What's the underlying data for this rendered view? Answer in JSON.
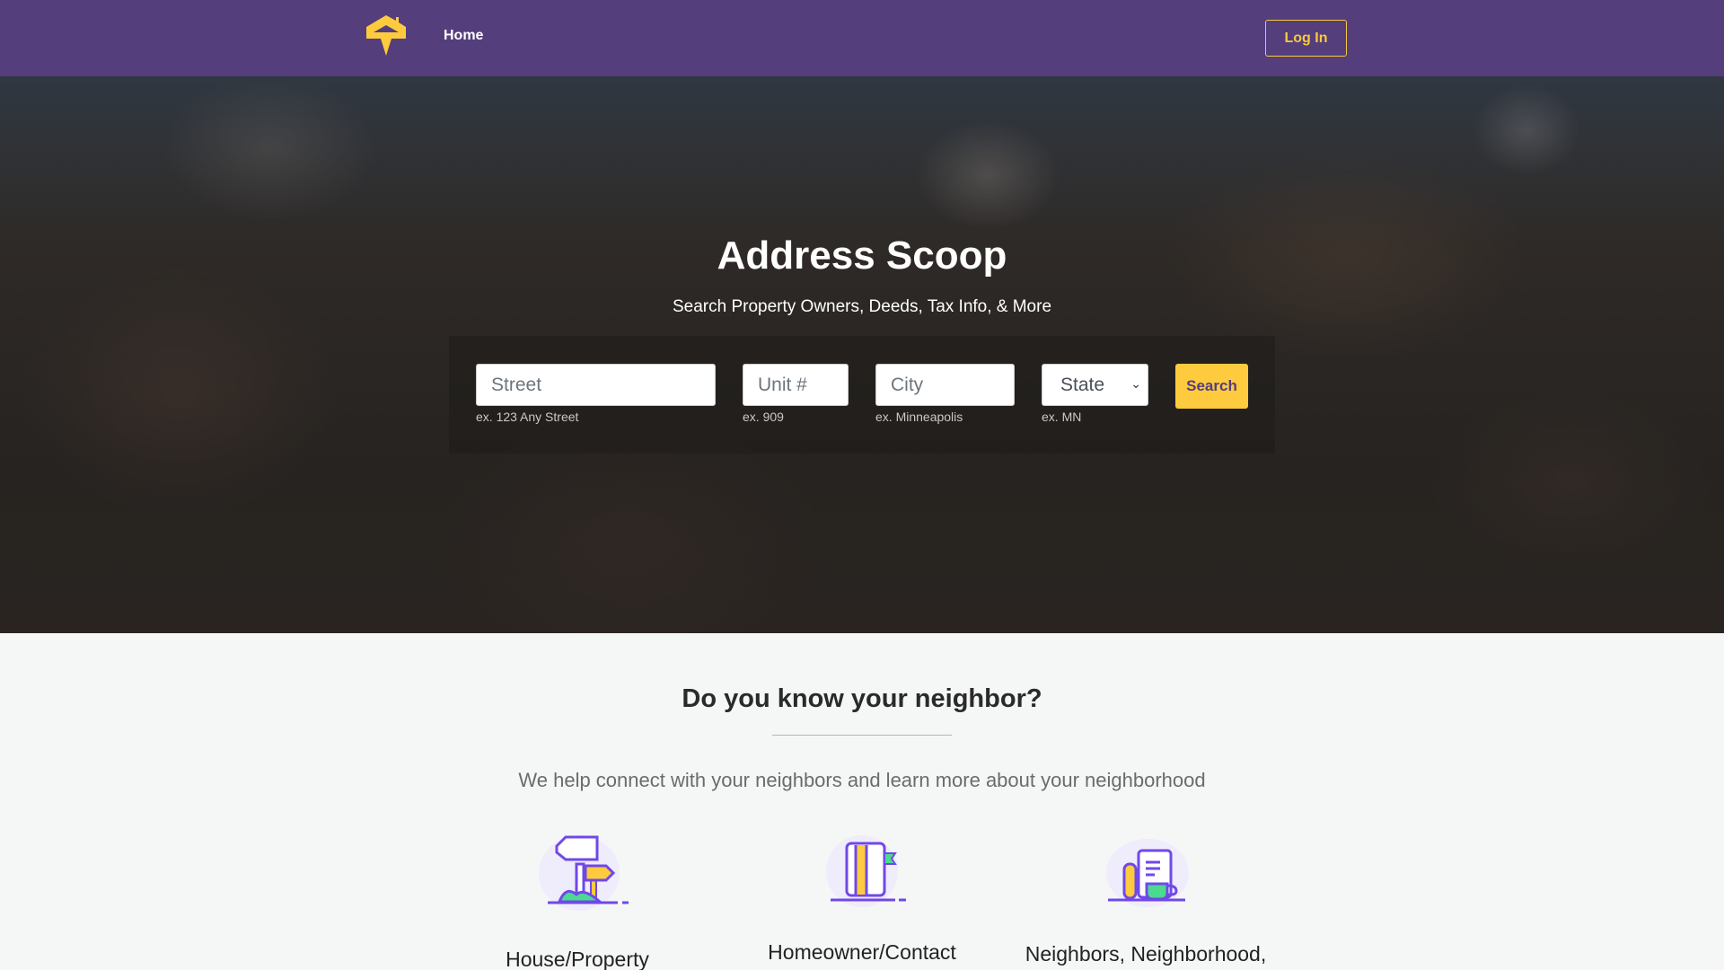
{
  "nav": {
    "logo_icon": "house-pin-logo-icon",
    "home_label": "Home",
    "login_label": "Log In"
  },
  "hero": {
    "title": "Address Scoop",
    "subtitle": "Search Property Owners, Deeds, Tax Info, & More"
  },
  "search_form": {
    "street": {
      "placeholder": "Street",
      "value": "",
      "hint": "ex. 123 Any Street"
    },
    "unit": {
      "placeholder": "Unit #",
      "value": "",
      "hint": "ex. 909"
    },
    "city": {
      "placeholder": "City",
      "value": "",
      "hint": "ex. Minneapolis"
    },
    "state": {
      "selected": "State",
      "hint": "ex. MN"
    },
    "search_label": "Search"
  },
  "about": {
    "title": "Do you know your neighbor?",
    "paragraph": "We help connect with your neighbors and learn more about your neighborhood"
  },
  "cards": [
    {
      "icon": "signpost-icon",
      "title": "House/Property"
    },
    {
      "icon": "book-icon",
      "title": "Homeowner/Contact"
    },
    {
      "icon": "newspaper-coffee-icon",
      "title": "Neighbors, Neighborhood,"
    }
  ],
  "colors": {
    "brand_purple": "#553e7c",
    "accent_yellow": "#fecb3f",
    "icon_purple": "#7048e8",
    "icon_green": "#4cd990"
  }
}
